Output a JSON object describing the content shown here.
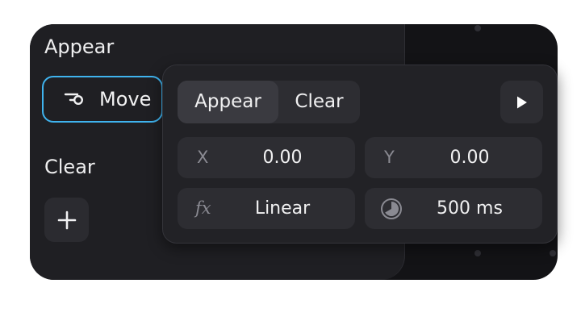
{
  "panel": {
    "appear_heading": "Appear",
    "move_label": "Move",
    "clear_heading": "Clear"
  },
  "popover": {
    "tabs": [
      "Appear",
      "Clear"
    ],
    "active_tab": "Appear",
    "x_label": "X",
    "x_value": "0.00",
    "y_label": "Y",
    "y_value": "0.00",
    "easing_label": "fx",
    "easing_value": "Linear",
    "duration_value": "500 ms"
  },
  "icons": [
    "move-icon",
    "add-icon",
    "play-icon",
    "function-icon",
    "clock-icon"
  ],
  "colors": {
    "accent": "#3fb3ee",
    "background": "#131316",
    "panel": "#1f1f23",
    "control": "#2d2d32"
  }
}
